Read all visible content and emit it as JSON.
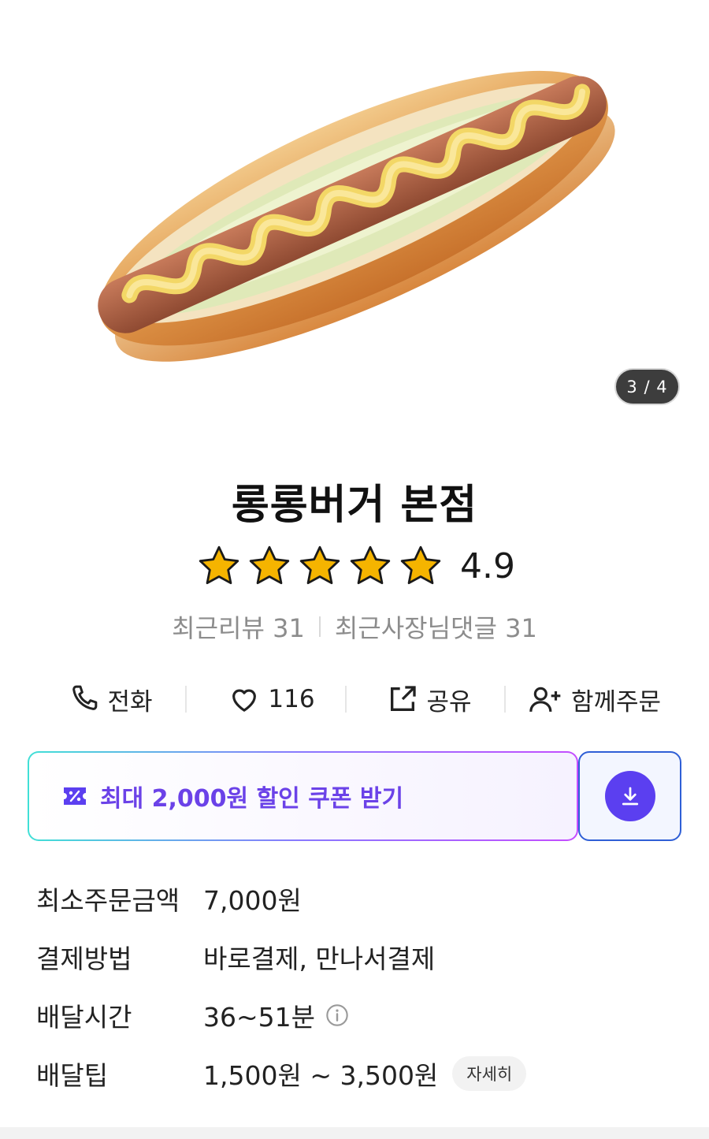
{
  "hero": {
    "page_indicator": "3 / 4"
  },
  "store": {
    "name": "롱롱버거 본점",
    "rating": "4.9",
    "stars": 5,
    "recent_reviews": "최근리뷰 31",
    "recent_owner_replies": "최근사장님댓글 31"
  },
  "actions": {
    "call": "전화",
    "like_count": "116",
    "share": "공유",
    "group_order": "함께주문"
  },
  "coupon": {
    "text": "최대 2,000원 할인 쿠폰 받기"
  },
  "info": {
    "min_order": {
      "label": "최소주문금액",
      "value": "7,000원"
    },
    "payment": {
      "label": "결제방법",
      "value": "바로결제, 만나서결제"
    },
    "delivery_time": {
      "label": "배달시간",
      "value": "36~51분"
    },
    "delivery_tip": {
      "label": "배달팁",
      "value": "1,500원 ~ 3,500원",
      "detail_button": "자세히"
    }
  },
  "colors": {
    "accent_purple": "#5b3ff0",
    "coupon_text": "#6b42e8",
    "star_gold": "#f5b400"
  },
  "icons": [
    "phone-icon",
    "heart-icon",
    "share-icon",
    "add-person-icon",
    "coupon-icon",
    "download-icon",
    "info-icon",
    "star-icon"
  ]
}
